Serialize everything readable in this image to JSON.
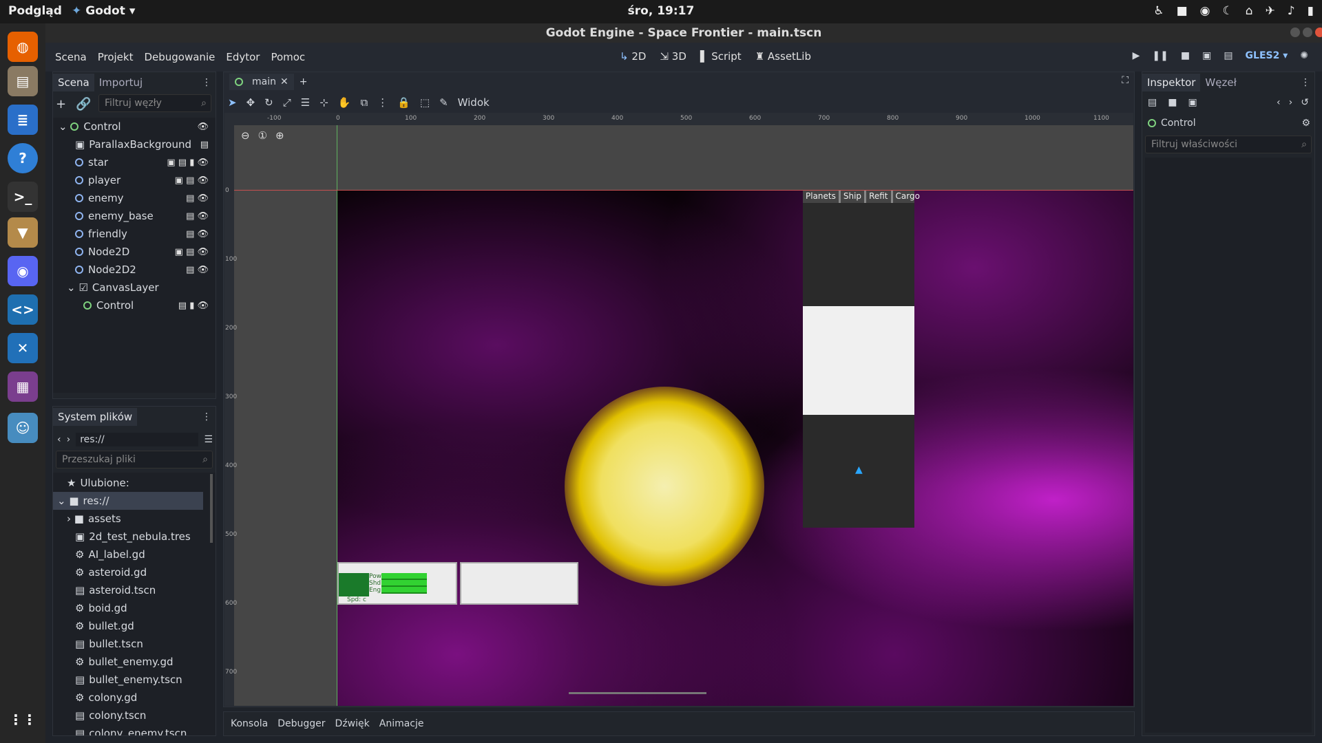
{
  "system": {
    "left_label": "Podgląd",
    "app_name": "Godot",
    "clock": "śro, 19:17"
  },
  "window": {
    "title": "Godot Engine - Space Frontier - main.tscn"
  },
  "menu": [
    "Scena",
    "Projekt",
    "Debugowanie",
    "Edytor",
    "Pomoc"
  ],
  "modes": [
    "2D",
    "3D",
    "Script",
    "AssetLib"
  ],
  "renderer": "GLES2",
  "scene_dock": {
    "tab_scene": "Scena",
    "tab_import": "Importuj",
    "filter_placeholder": "Filtruj węzły",
    "nodes": [
      {
        "label": "Control",
        "indent": 0,
        "kind": "green"
      },
      {
        "label": "ParallaxBackground",
        "indent": 1,
        "kind": "bg"
      },
      {
        "label": "star",
        "indent": 1,
        "kind": "blue"
      },
      {
        "label": "player",
        "indent": 1,
        "kind": "blue"
      },
      {
        "label": "enemy",
        "indent": 1,
        "kind": "blue"
      },
      {
        "label": "enemy_base",
        "indent": 1,
        "kind": "blue"
      },
      {
        "label": "friendly",
        "indent": 1,
        "kind": "blue"
      },
      {
        "label": "Node2D",
        "indent": 1,
        "kind": "blue"
      },
      {
        "label": "Node2D2",
        "indent": 1,
        "kind": "blue"
      },
      {
        "label": "CanvasLayer",
        "indent": 1,
        "kind": "canvas"
      },
      {
        "label": "Control",
        "indent": 2,
        "kind": "green"
      }
    ]
  },
  "filesystem": {
    "title": "System plików",
    "path": "res://",
    "search_placeholder": "Przeszukaj pliki",
    "items": [
      "Ulubione:",
      "res://",
      "assets",
      "2d_test_nebula.tres",
      "AI_label.gd",
      "asteroid.gd",
      "asteroid.tscn",
      "boid.gd",
      "bullet.gd",
      "bullet.tscn",
      "bullet_enemy.gd",
      "bullet_enemy.tscn",
      "colony.gd",
      "colony.tscn",
      "colony_enemy.tscn"
    ]
  },
  "editor": {
    "scene_tab": "main",
    "view_menu": "Widok",
    "ruler_h": [
      "-100",
      "0",
      "100",
      "200",
      "300",
      "400",
      "500",
      "600",
      "700",
      "800",
      "900",
      "1000",
      "1100"
    ],
    "ruler_v": [
      "0",
      "100",
      "200",
      "300",
      "400",
      "500",
      "600",
      "700"
    ],
    "game_tabs": [
      "Planets",
      "Ship",
      "Refit",
      "Cargo"
    ],
    "hud": {
      "pow": "Pow",
      "shd": "Shd",
      "eng": "Eng",
      "spd": "Spd: c"
    }
  },
  "bottom_tabs": [
    "Konsola",
    "Debugger",
    "Dźwięk",
    "Animacje"
  ],
  "inspector": {
    "tab_inspector": "Inspektor",
    "tab_node": "Węzeł",
    "node": "Control",
    "filter_placeholder": "Filtruj właściwości"
  }
}
